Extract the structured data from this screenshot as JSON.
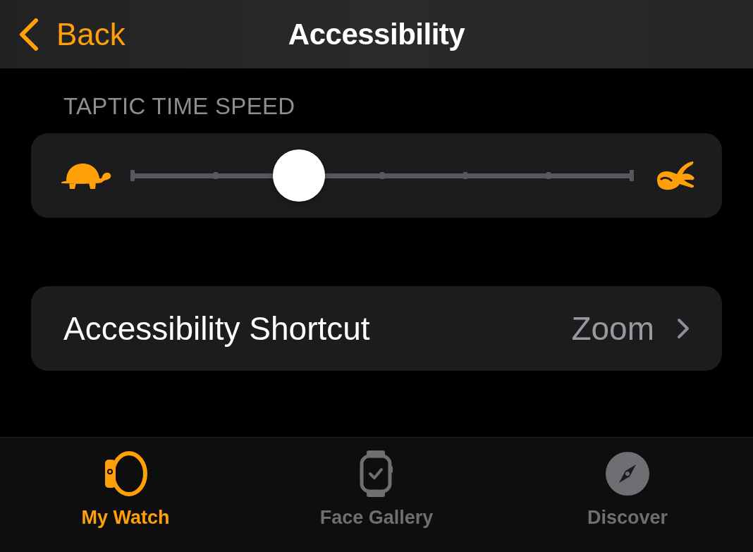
{
  "nav": {
    "back": "Back",
    "title": "Accessibility"
  },
  "sections": [
    {
      "kind": "slider",
      "header": "TAPTIC TIME SPEED",
      "level": 0.333
    },
    {
      "kind": "row",
      "label": "Accessibility Shortcut",
      "value": "Zoom"
    }
  ],
  "tab_bar": [
    {
      "label": "My Watch",
      "selected": true
    },
    {
      "label": "Face Gallery",
      "selected": false
    },
    {
      "label": "Discover",
      "selected": false
    }
  ]
}
